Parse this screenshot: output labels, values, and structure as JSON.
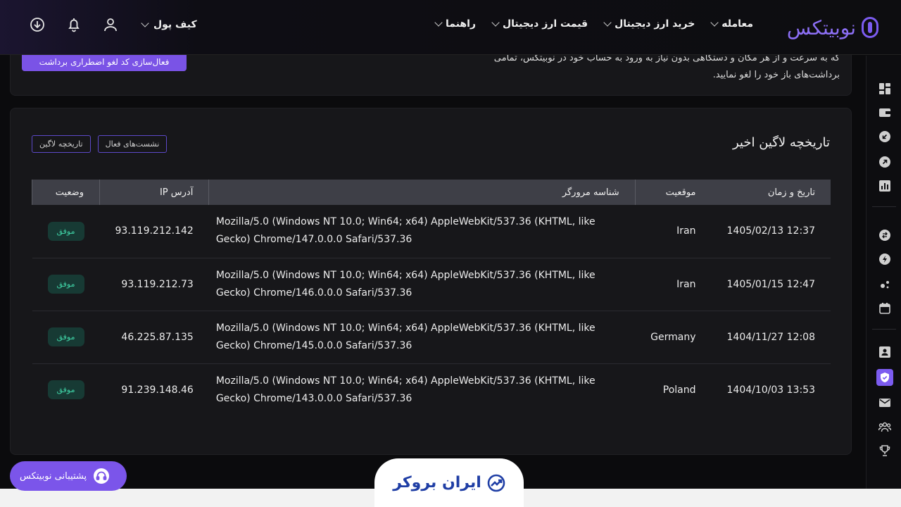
{
  "header": {
    "logo_text": "نوبیتکس",
    "nav": [
      {
        "label": "معامله"
      },
      {
        "label": "خرید ارز دیجیتال"
      },
      {
        "label": "قیمت ارز دیجیتال"
      },
      {
        "label": "راهنما"
      }
    ],
    "wallet_label": "کیف پول",
    "icons": [
      "download-icon",
      "bell-icon",
      "user-icon"
    ]
  },
  "top_card": {
    "text": "که به سرعت و از هر مکان و دستگاهی بدون نیاز به ورود به حساب خود در نوبیتکس، تمامی برداشت‌های باز خود را لغو نمایید.",
    "button_label": "فعال‌سازی کد لغو اضطراری برداشت"
  },
  "login_history": {
    "title": "تاریخچه لاگین اخیر",
    "tabs": [
      "نشست‌های فعال",
      "تاریخچه لاگین"
    ],
    "columns": {
      "datetime": "تاریخ و زمان",
      "location": "موقعیت",
      "browser": "شناسه مرورگر",
      "ip": "آدرس IP",
      "status": "وضعیت"
    },
    "rows": [
      {
        "datetime": "1405/02/13 12:37",
        "location": "Iran",
        "browser": "Mozilla/5.0 (Windows NT 10.0; Win64; x64) AppleWebKit/537.36 (KHTML, like Gecko) Chrome/147.0.0.0 Safari/537.36",
        "ip": "93.119.212.142",
        "status": "موفق"
      },
      {
        "datetime": "1405/01/15 12:47",
        "location": "Iran",
        "browser": "Mozilla/5.0 (Windows NT 10.0; Win64; x64) AppleWebKit/537.36 (KHTML, like Gecko) Chrome/146.0.0.0 Safari/537.36",
        "ip": "93.119.212.73",
        "status": "موفق"
      },
      {
        "datetime": "1404/11/27 12:08",
        "location": "Germany",
        "browser": "Mozilla/5.0 (Windows NT 10.0; Win64; x64) AppleWebKit/537.36 (KHTML, like Gecko) Chrome/145.0.0.0 Safari/537.36",
        "ip": "46.225.87.135",
        "status": "موفق"
      },
      {
        "datetime": "1404/10/03 13:53",
        "location": "Poland",
        "browser": "Mozilla/5.0 (Windows NT 10.0; Win64; x64) AppleWebKit/537.36 (KHTML, like Gecko) Chrome/143.0.0.0 Safari/537.36",
        "ip": "91.239.148.46",
        "status": "موفق"
      }
    ]
  },
  "support": {
    "label": "پشتیبانی نوبیتکس"
  },
  "watermark": {
    "text": "ایران بروکر"
  },
  "sidebar": {
    "icons": [
      "dashboard-icon",
      "wallet-icon",
      "deposit-icon",
      "withdraw-icon",
      "chart-icon",
      "exchange-icon",
      "lightning-icon",
      "dots-icon",
      "calendar-icon",
      "profile-icon",
      "security-icon",
      "mail-icon",
      "referral-icon",
      "trophy-icon"
    ],
    "active": "security-icon"
  },
  "colors": {
    "accent": "#7c5cf0",
    "success": "#3fd0a4",
    "table_header": "#3e3f47"
  }
}
